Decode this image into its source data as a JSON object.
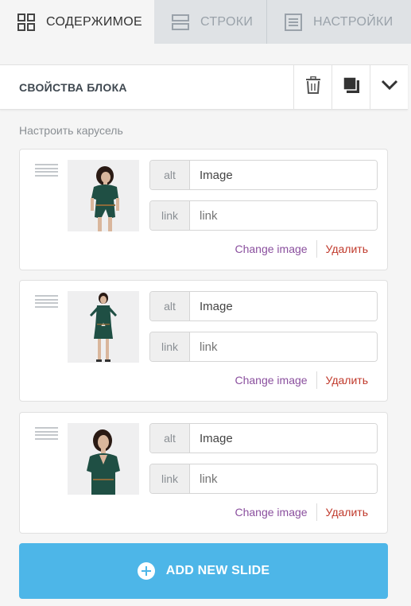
{
  "tabs": [
    {
      "label": "СОДЕРЖИМОЕ",
      "icon": "grid-icon",
      "active": true
    },
    {
      "label": "СТРОКИ",
      "icon": "rows-icon",
      "active": false
    },
    {
      "label": "НАСТРОЙКИ",
      "icon": "settings-list-icon",
      "active": false
    }
  ],
  "block": {
    "title": "СВОЙСТВА БЛОКА",
    "actions": [
      "trash-icon",
      "duplicate-icon",
      "chevron-down-icon"
    ]
  },
  "carousel_label": "Настроить карусель",
  "slides": [
    {
      "alt_label": "alt",
      "alt_value": "Image",
      "link_label": "link",
      "link_placeholder": "link",
      "change_label": "Change image",
      "delete_label": "Удалить"
    },
    {
      "alt_label": "alt",
      "alt_value": "Image",
      "link_label": "link",
      "link_placeholder": "link",
      "change_label": "Change image",
      "delete_label": "Удалить"
    },
    {
      "alt_label": "alt",
      "alt_value": "Image",
      "link_label": "link",
      "link_placeholder": "link",
      "change_label": "Change image",
      "delete_label": "Удалить"
    }
  ],
  "add_button_label": "ADD NEW SLIDE",
  "colors": {
    "accent": "#4db6e8",
    "change_link": "#8a4f9e",
    "delete_link": "#c0392b",
    "dress": "#1f4f44"
  }
}
